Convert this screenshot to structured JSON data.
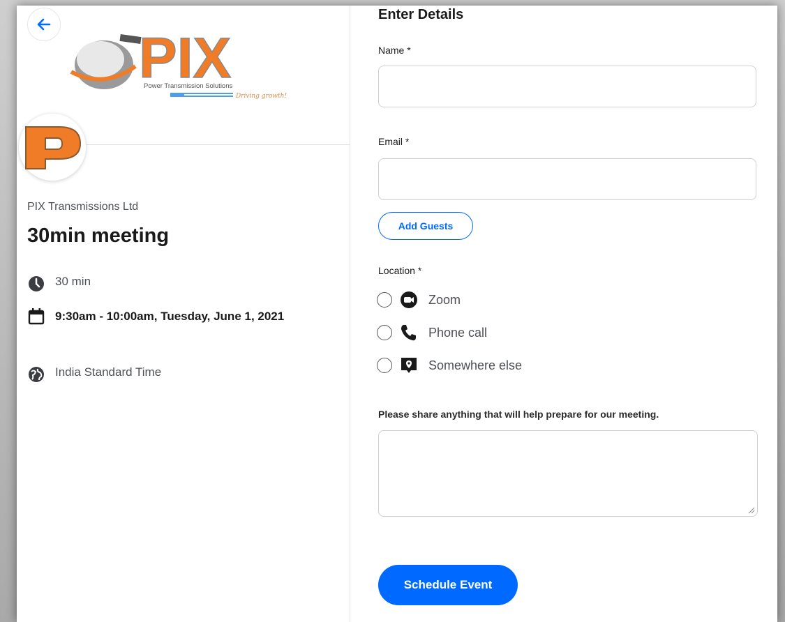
{
  "company": {
    "logo_text": "PIX",
    "logo_tagline": "Power Transmission Solutions",
    "logo_slogan": "Driving growth!",
    "avatar_letter": "P",
    "brand_color": "#f07c28"
  },
  "event": {
    "organizer": "PIX Transmissions Ltd",
    "title": "30min meeting",
    "duration": "30 min",
    "datetime": "9:30am - 10:00am, Tuesday, June 1, 2021",
    "timezone": "India Standard Time"
  },
  "form": {
    "heading": "Enter Details",
    "name_label": "Name *",
    "name_value": "",
    "email_label": "Email *",
    "email_value": "",
    "add_guests_label": "Add Guests",
    "location_label": "Location *",
    "location_options": [
      {
        "label": "Zoom",
        "icon": "zoom-icon",
        "selected": false
      },
      {
        "label": "Phone call",
        "icon": "phone-icon",
        "selected": false
      },
      {
        "label": "Somewhere else",
        "icon": "location-pin-icon",
        "selected": false
      }
    ],
    "notes_label": "Please share anything that will help prepare for our meeting.",
    "notes_value": "",
    "submit_label": "Schedule Event"
  },
  "colors": {
    "accent": "#0069ff",
    "text_primary": "#1a1a1a",
    "text_secondary": "#4d5055"
  }
}
